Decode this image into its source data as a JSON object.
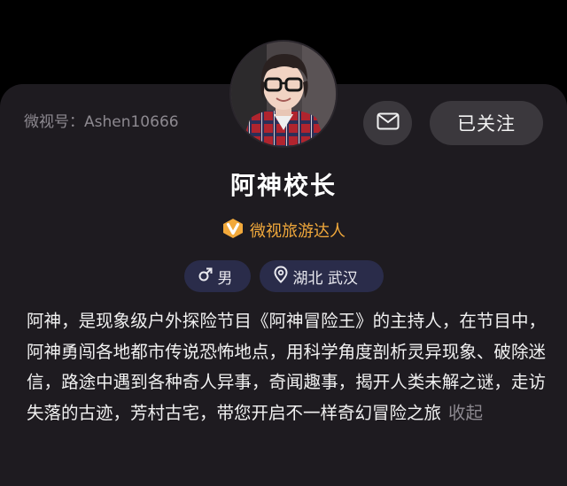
{
  "profile": {
    "weishi_id": "微视号：Ashen10666",
    "nickname": "阿神校长",
    "badge_label": "微视旅游达人",
    "gender": "男",
    "location": "湖北 武汉",
    "bio": "阿神，是现象级户外探险节目《阿神冒险王》的主持人，在节目中，阿神勇闯各地都市传说恐怖地点，用科学角度剖析灵异现象、破除迷信，路途中遇到各种奇人异事，奇闻趣事，揭开人类未解之谜，走访失落的古迹，芳村古宅，带您开启不一样奇幻冒险之旅",
    "collapse_label": "收起"
  },
  "actions": {
    "message_icon": "mail-icon",
    "follow_label": "已关注"
  },
  "icons": {
    "badge": "verified-v-icon",
    "gender": "male-icon",
    "location": "location-pin-icon"
  },
  "colors": {
    "background": "#1e1b20",
    "badge": "#f2a93b",
    "tag_bg": "#2a2c4a",
    "button_bg": "#3b383d"
  }
}
